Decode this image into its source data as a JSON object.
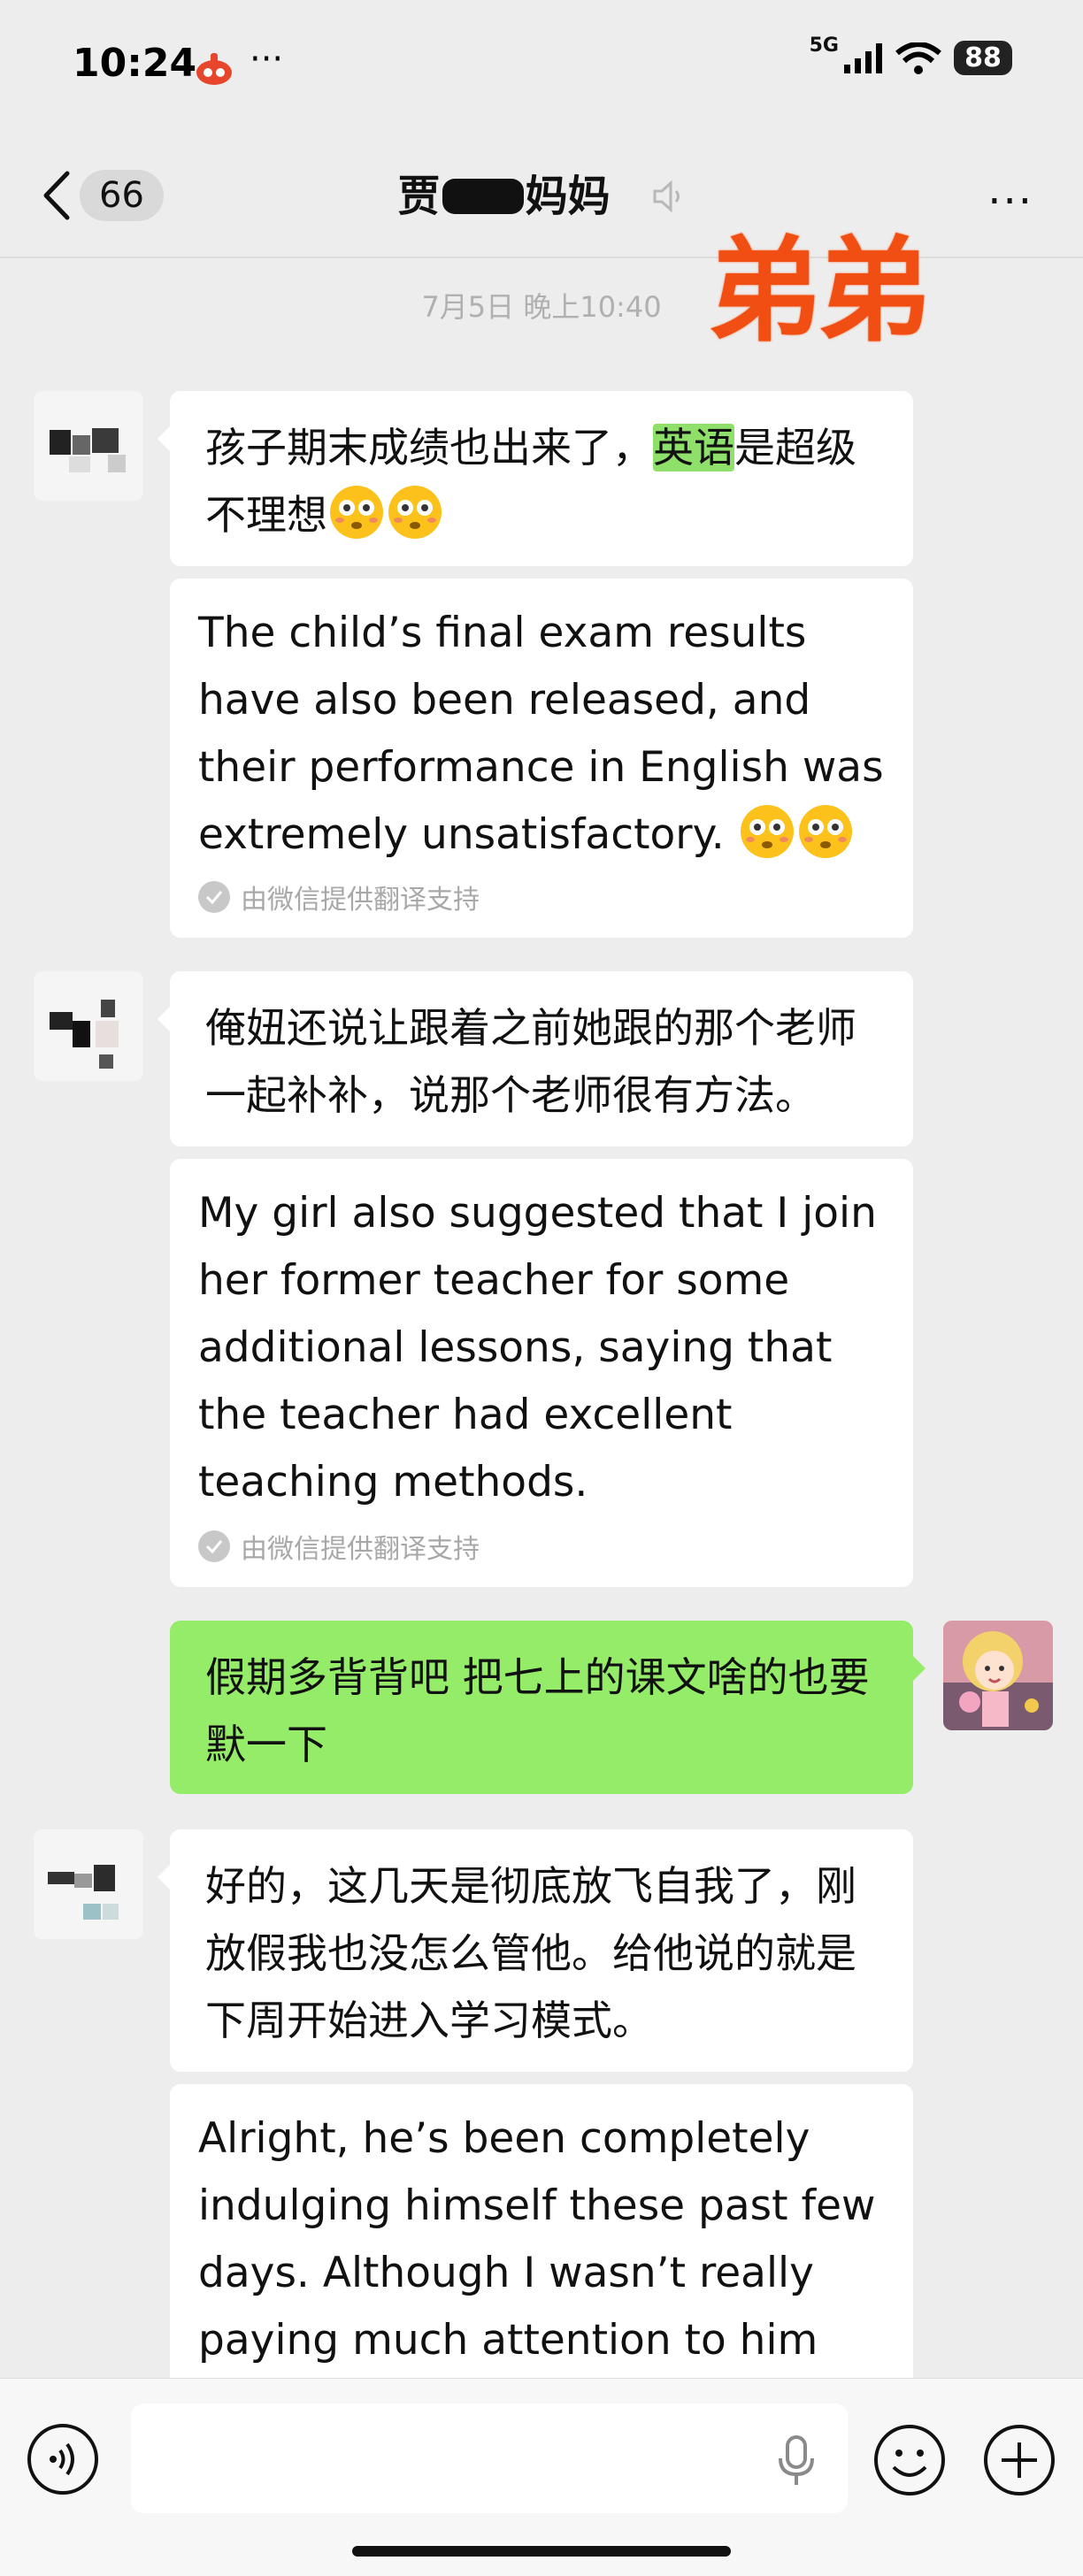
{
  "status_bar": {
    "time": "10:24",
    "dots": "···",
    "network": "5G",
    "battery": "88"
  },
  "nav": {
    "unread_count": "66",
    "title_start": "贾",
    "title_end": "妈妈"
  },
  "overlay_stamp": "弟弟",
  "timestamp": "7月5日 晚上10:40",
  "messages": {
    "m1": {
      "zh_before": "孩子期末成绩也出来了，",
      "zh_highlight": "英语",
      "zh_after": "是超级不理想",
      "en": "The child’s final exam results have also been released, and their performance in English was extremely unsatisfactory. ",
      "credit": "由微信提供翻译支持"
    },
    "m2": {
      "zh": "俺妞还说让跟着之前她跟的那个老师一起补补，说那个老师很有方法。",
      "en": "My girl also suggested that I join her former teacher for some additional lessons, saying that the teacher had excellent teaching methods.",
      "credit": "由微信提供翻译支持"
    },
    "m3": {
      "zh": "假期多背背吧 把七上的课文啥的也要默一下"
    },
    "m4": {
      "zh": "好的，这几天是彻底放飞自我了，刚放假我也没怎么管他。给他说的就是下周开始进入学习模式。",
      "en": "Alright, he’s been completely indulging himself these past few days. Although I wasn’t really paying much attention to him"
    }
  },
  "icons": {
    "back": "chevron-left-icon",
    "mute": "mute-icon",
    "more": "more-icon",
    "voice": "voice-icon",
    "mic": "mic-icon",
    "emoji": "emoji-icon",
    "plus": "plus-icon",
    "flushed": "flushed-face-emoji"
  },
  "colors": {
    "background": "#ededed",
    "incoming_bubble": "#ffffff",
    "outgoing_bubble": "#95ec69",
    "highlight": "#8fe06b",
    "stamp": "#f04e12"
  }
}
